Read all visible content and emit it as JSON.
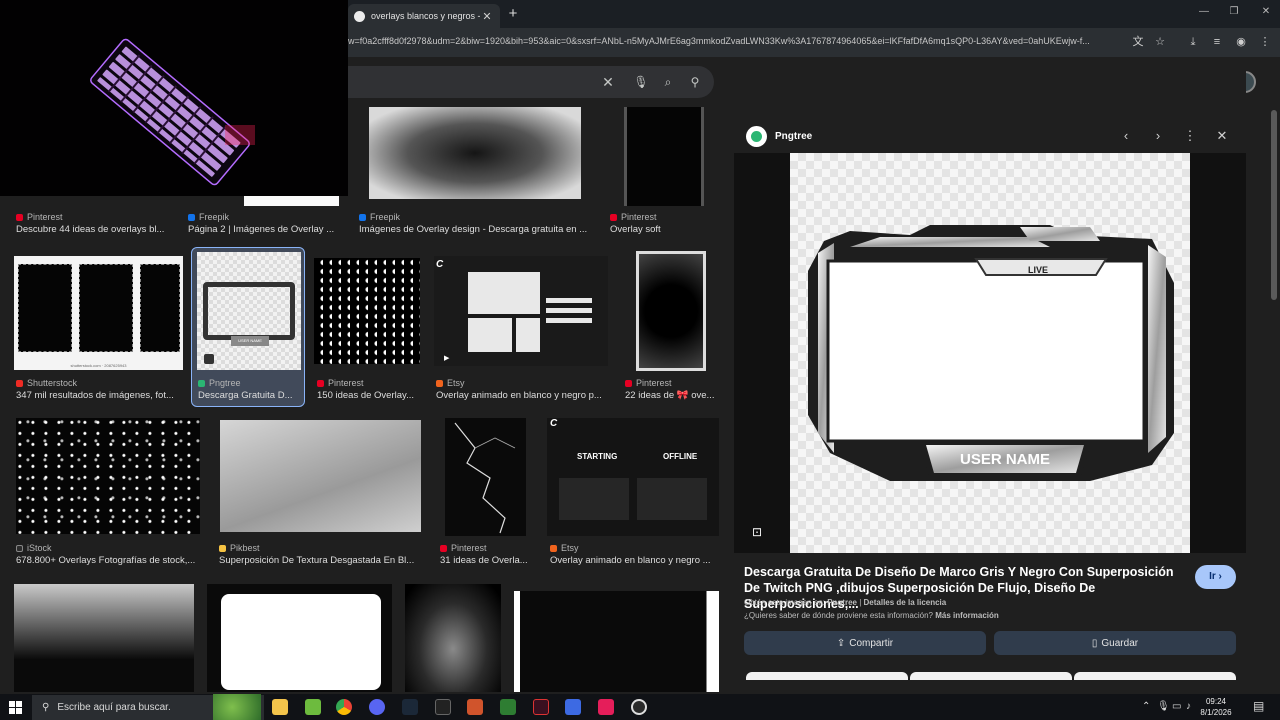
{
  "browser": {
    "tab_title": "overlays blancos y negros - Bu",
    "url": "w=f0a2cfff8d0f2978&udm=2&biw=1920&bih=953&aic=0&sxsrf=ANbL-n5MyAJMrE6ag3mmkodZvadLWN33Kw%3A1767874964065&ei=lKFfafDfA6mq1sQP0-L36AY&ved=0ahUKEwjw-f..."
  },
  "results": [
    {
      "source": "Pinterest",
      "title": "Descubre 44 ideas de overlays bl...",
      "color": "#e60023"
    },
    {
      "source": "Freepik",
      "title": "Página 2 | Imágenes de Overlay ...",
      "color": "#1273eb"
    },
    {
      "source": "Freepik",
      "title": "Imágenes de Overlay design - Descarga gratuita en ...",
      "color": "#1273eb"
    },
    {
      "source": "Pinterest",
      "title": "Overlay soft",
      "color": "#e60023"
    },
    {
      "source": "Shutterstock",
      "title": "347 mil resultados de imágenes, fot...",
      "color": "#ee2b24"
    },
    {
      "source": "Pngtree",
      "title": "Descarga Gratuita D...",
      "color": "#2bb673"
    },
    {
      "source": "Pinterest",
      "title": "150 ideas de Overlay...",
      "color": "#e60023"
    },
    {
      "source": "Etsy",
      "title": "Overlay animado en blanco y negro p...",
      "color": "#f1641e"
    },
    {
      "source": "Pinterest",
      "title": "22 ideas de 🎀 ove...",
      "color": "#e60023"
    },
    {
      "source": "iStock",
      "title": "678.800+ Overlays Fotografías de stock,...",
      "color": "#2c2c2c"
    },
    {
      "source": "Pikbest",
      "title": "Superposición De Textura Desgastada En Bl...",
      "color": "#f5c242"
    },
    {
      "source": "Pinterest",
      "title": "31 ideas de Overla...",
      "color": "#e60023"
    },
    {
      "source": "Etsy",
      "title": "Overlay animado en blanco y negro ...",
      "color": "#f1641e"
    }
  ],
  "thumb_text": {
    "shutter_watermark": "shutterstock.com · 2087625943",
    "pngtree_frame": "USER NAME",
    "starting": "STARTING",
    "offline": "OFFLINE",
    "etsy_logo": "C"
  },
  "panel": {
    "source": "Pngtree",
    "frame_live": "LIVE",
    "frame_username": "USER NAME",
    "title": "Descarga Gratuita De Diseño De Marco Gris Y Negro Con Superposición De Twitch PNG ,dibujos Superposición De Flujo, Diseño De Superposiciones,...",
    "visit_label": "Ir",
    "obtained_prefix": "Obtén esta imagen en:",
    "obtained_source": "Pngtree",
    "license_link": "Detalles de la licencia",
    "question": "¿Quieres saber de dónde proviene esta información?",
    "more_info": "Más información",
    "share_label": "Compartir",
    "save_label": "Guardar"
  },
  "taskbar": {
    "search_placeholder": "Escribe aquí para buscar.",
    "time": "09:24",
    "date": "8/1/2026"
  },
  "colors": {
    "accent": "#a8c7fa",
    "background": "#1f1f1f",
    "button": "#303c4c"
  }
}
